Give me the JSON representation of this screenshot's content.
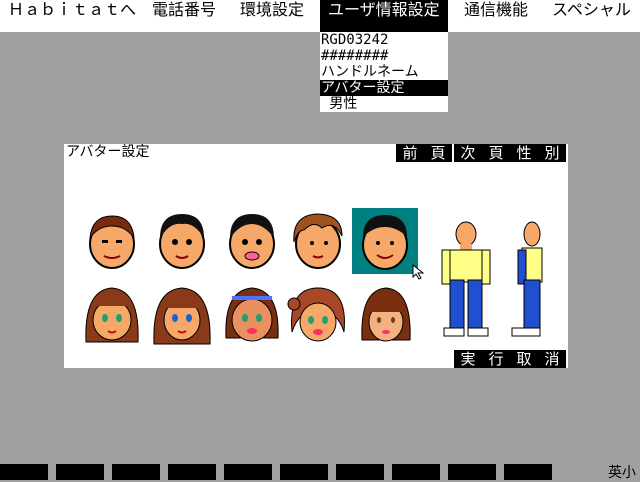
{
  "menubar": {
    "items": [
      {
        "label": "Ｈａｂｉｔａｔへ"
      },
      {
        "label": "電話番号"
      },
      {
        "label": "環境設定"
      },
      {
        "label": "ユーザ情報設定"
      },
      {
        "label": "通信機能"
      },
      {
        "label": "スペシャル"
      }
    ],
    "active_index": 3
  },
  "dropdown": {
    "items": [
      {
        "label": "RGD03242"
      },
      {
        "label": "########"
      },
      {
        "label": "ハンドルネーム"
      },
      {
        "label": "アバター設定"
      },
      {
        "label": " 男性"
      }
    ],
    "selected_index": 3
  },
  "avatar_window": {
    "title": "アバター設定",
    "header_buttons": [
      "前頁",
      "次頁",
      "性別"
    ],
    "footer_buttons": [
      "実行",
      "取消"
    ],
    "selected_face_index": 4
  },
  "taskbar": {
    "ime_label": "英小"
  },
  "colors": {
    "background": "#a0a0a0",
    "selection": "#008080",
    "skin": "#f5a868",
    "shirt": "#ffff88",
    "pants": "#2050d0"
  }
}
